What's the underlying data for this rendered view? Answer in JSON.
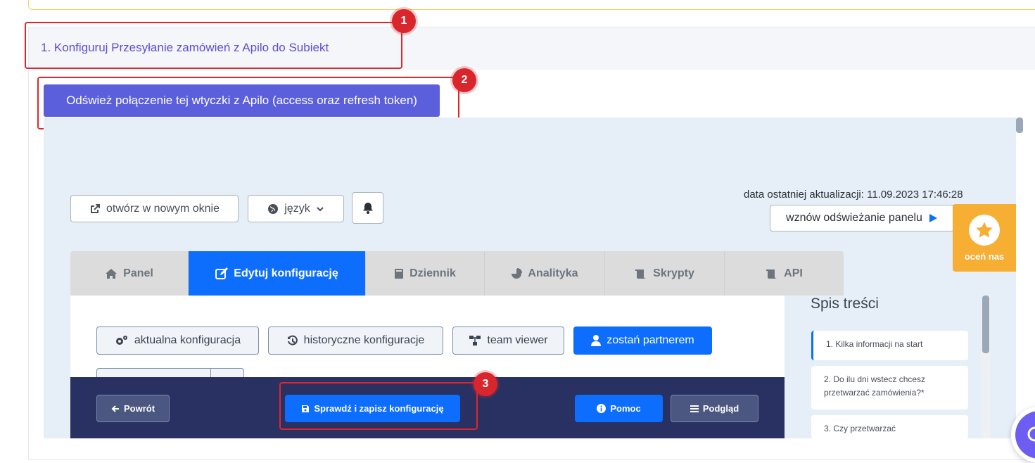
{
  "header": {
    "title": "1. Konfiguruj Przesyłanie zamówień z Apilo do Subiekt",
    "refresh_button": "Odśwież połączenie tej wtyczki z Apilo (access oraz refresh token)"
  },
  "annotations": {
    "badge1": "1",
    "badge2": "2",
    "badge3": "3"
  },
  "toolbar": {
    "open_new_window": "otwórz w nowym oknie",
    "language": "język",
    "last_update": "data ostatniej aktualizacji: 11.09.2023 17:46:28",
    "resume_refresh": "wznów odświeżanie panelu"
  },
  "rate_widget": {
    "label": "oceń nas"
  },
  "tabs": [
    {
      "label": "Panel",
      "icon": "home-icon"
    },
    {
      "label": "Edytuj konfigurację",
      "icon": "edit-icon",
      "active": true
    },
    {
      "label": "Dziennik",
      "icon": "book-icon"
    },
    {
      "label": "Analityka",
      "icon": "pie-chart-icon"
    },
    {
      "label": "Skrypty",
      "icon": "scroll-icon"
    },
    {
      "label": "API",
      "icon": "scroll-icon"
    }
  ],
  "sub_buttons": {
    "current_config": "aktualna konfiguracja",
    "history_config": "historyczne konfiguracje",
    "team_viewer": "team viewer",
    "become_partner": "zostań partnerem"
  },
  "toc": {
    "title": "Spis treści",
    "items": [
      "1. Kilka informacji na start",
      "2. Do ilu dni wstecz chcesz przetwarzać zamówienia?*",
      "3. Czy przetwarzać"
    ]
  },
  "footer": {
    "back": "Powrót",
    "check_save": "Sprawdź i zapisz konfigurację",
    "help": "Pomoc",
    "preview": "Podgląd"
  },
  "colors": {
    "accent_purple": "#5b5fdc",
    "primary_blue": "#0d6efd",
    "footer_navy": "#283161",
    "callout_red": "#e0262b",
    "rate_orange": "#f6ae33"
  }
}
